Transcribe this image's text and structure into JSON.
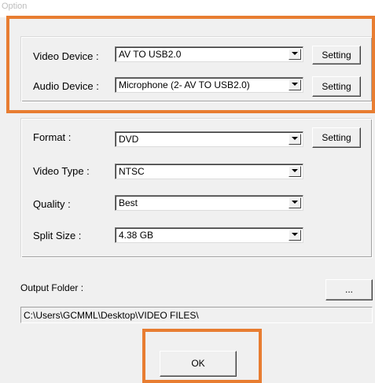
{
  "window": {
    "title": "Option"
  },
  "devices": {
    "video_label": "Video Device :",
    "video_value": "AV TO USB2.0",
    "audio_label": "Audio Device :",
    "audio_value": "Microphone (2- AV TO USB2.0)",
    "setting_label": "Setting"
  },
  "encoding": {
    "format_label": "Format :",
    "format_value": "DVD",
    "type_label": "Video Type :",
    "type_value": "NTSC",
    "quality_label": "Quality :",
    "quality_value": "Best",
    "split_label": "Split Size :",
    "split_value": "4.38 GB",
    "setting_label": "Setting"
  },
  "output": {
    "label": "Output Folder :",
    "browse_label": "...",
    "path": "C:\\Users\\GCMML\\Desktop\\VIDEO FILES\\"
  },
  "footer": {
    "ok_label": "OK"
  },
  "colors": {
    "highlight": "#e87d31",
    "window_bg": "#f0f0f0"
  }
}
